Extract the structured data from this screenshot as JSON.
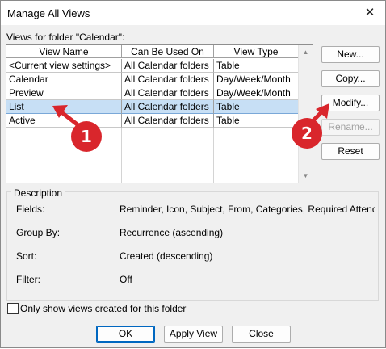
{
  "window": {
    "title": "Manage All Views",
    "close_glyph": "✕"
  },
  "views_label": "Views for folder \"Calendar\":",
  "columns": [
    "View Name",
    "Can Be Used On",
    "View Type"
  ],
  "rows": [
    [
      "<Current view settings>",
      "All Calendar folders",
      "Table"
    ],
    [
      "Calendar",
      "All Calendar folders",
      "Day/Week/Month"
    ],
    [
      "Preview",
      "All Calendar folders",
      "Day/Week/Month"
    ],
    [
      "List",
      "All Calendar folders",
      "Table"
    ],
    [
      "Active",
      "All Calendar folders",
      "Table"
    ]
  ],
  "selected_row_index": 3,
  "side_buttons": {
    "new": "New...",
    "copy": "Copy...",
    "modify": "Modify...",
    "rename": "Rename...",
    "reset": "Reset"
  },
  "description": {
    "title": "Description",
    "fields_label": "Fields:",
    "fields_value": "Reminder, Icon, Subject, From, Categories, Required Attendees",
    "group_label": "Group By:",
    "group_value": "Recurrence (ascending)",
    "sort_label": "Sort:",
    "sort_value": "Created (descending)",
    "filter_label": "Filter:",
    "filter_value": "Off"
  },
  "only_show_label": "Only show views created for this folder",
  "only_show_checked": false,
  "footer": {
    "ok": "OK",
    "apply": "Apply View",
    "close": "Close"
  },
  "annotations": {
    "badge1": "1",
    "badge2": "2",
    "color": "#d9262c"
  },
  "icons": {
    "scroll_up": "▲",
    "scroll_down": "▼"
  }
}
